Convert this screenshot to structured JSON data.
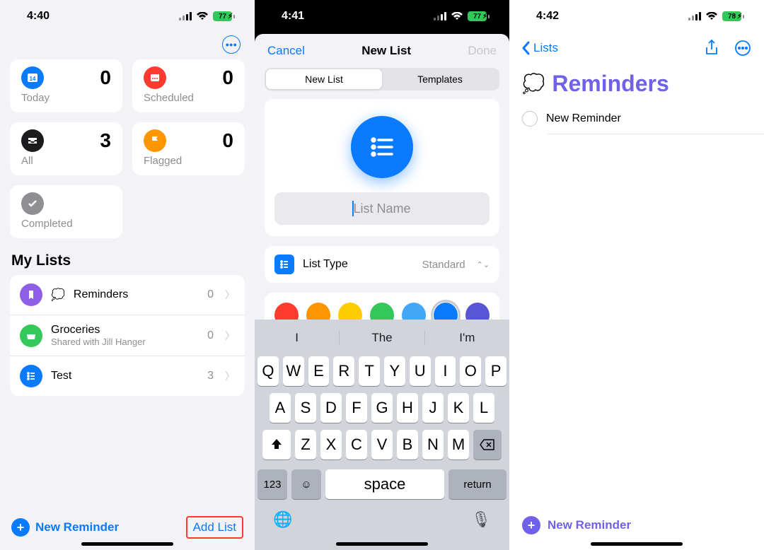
{
  "screen1": {
    "time": "4:40",
    "battery": "77",
    "cards": {
      "today": {
        "label": "Today",
        "count": "0"
      },
      "scheduled": {
        "label": "Scheduled",
        "count": "0"
      },
      "all": {
        "label": "All",
        "count": "3"
      },
      "flagged": {
        "label": "Flagged",
        "count": "0"
      },
      "completed": {
        "label": "Completed"
      }
    },
    "mylists_header": "My Lists",
    "lists": [
      {
        "title": "Reminders",
        "sub": "",
        "count": "0"
      },
      {
        "title": "Groceries",
        "sub": "Shared with Jill Hanger",
        "count": "0"
      },
      {
        "title": "Test",
        "sub": "",
        "count": "3"
      }
    ],
    "new_reminder": "New Reminder",
    "add_list": "Add List"
  },
  "screen2": {
    "time": "4:41",
    "battery": "77",
    "nav": {
      "cancel": "Cancel",
      "title": "New List",
      "done": "Done"
    },
    "segments": {
      "newlist": "New List",
      "templates": "Templates"
    },
    "placeholder": "List Name",
    "list_type_label": "List Type",
    "list_type_value": "Standard",
    "colors_row1": [
      "#ff3b30",
      "#ff9500",
      "#ffcc00",
      "#34c759",
      "#42a8f5",
      "#0a7aff",
      "#5856d6"
    ],
    "colors_row2": [
      "#ef3d77",
      "#bd62e8",
      "#9b8563",
      "#5b6670",
      "#e8a79c"
    ],
    "selected_color_index": 5,
    "suggestions": [
      "I",
      "The",
      "I'm"
    ],
    "rows": [
      [
        "Q",
        "W",
        "E",
        "R",
        "T",
        "Y",
        "U",
        "I",
        "O",
        "P"
      ],
      [
        "A",
        "S",
        "D",
        "F",
        "G",
        "H",
        "J",
        "K",
        "L"
      ],
      [
        "Z",
        "X",
        "C",
        "V",
        "B",
        "N",
        "M"
      ]
    ],
    "key_123": "123",
    "key_space": "space",
    "key_return": "return"
  },
  "screen3": {
    "time": "4:42",
    "battery": "78",
    "back": "Lists",
    "title": "Reminders",
    "item": "New Reminder",
    "new_reminder": "New Reminder"
  }
}
